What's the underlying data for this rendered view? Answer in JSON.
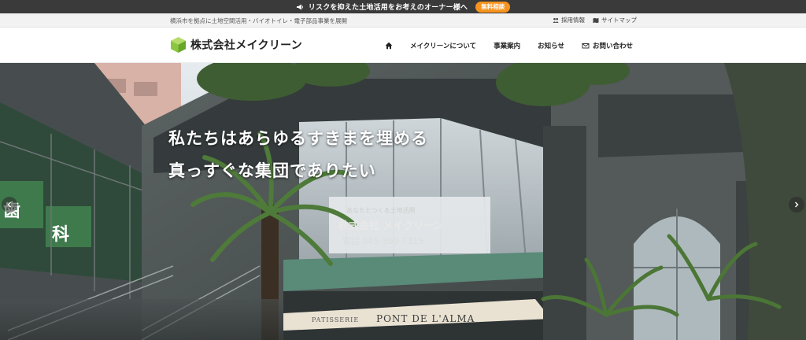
{
  "announcement": {
    "text": "リスクを抑えた土地活用をお考えのオーナー様へ",
    "button": "無料相談",
    "icon": "megaphone-icon"
  },
  "utility": {
    "tagline": "横浜市を拠点に土地空間活用・バイオトイレ・電子部品事業を展開",
    "links": [
      {
        "label": "採用情報",
        "icon": "people-icon"
      },
      {
        "label": "サイトマップ",
        "icon": "map-icon"
      }
    ]
  },
  "header": {
    "logo_text": "株式会社メイクリーン",
    "logo_color": "#8cc63f",
    "nav": [
      {
        "label": "",
        "icon": "home-icon"
      },
      {
        "label": "メイクリーンについて"
      },
      {
        "label": "事業案内"
      },
      {
        "label": "お知らせ"
      },
      {
        "label": "お問い合わせ",
        "icon": "mail-icon"
      }
    ]
  },
  "hero": {
    "headline_line1": "私たちはあらゆるすきまを埋める",
    "headline_line2": "真っすぐな集団でありたい",
    "sign": {
      "line1": "あなたとつくる土地活用",
      "line2": "株式会社 メイクリーン",
      "line3": "電話 045-309-7315"
    },
    "clinic_chars": [
      "歯",
      "科"
    ],
    "awning_small": "PATISSERIE",
    "awning_main": "PONT DE L'ALMA"
  },
  "colors": {
    "accent_orange": "#f7931e",
    "brand_green": "#8cc63f",
    "topbar": "#3a3a3a"
  }
}
